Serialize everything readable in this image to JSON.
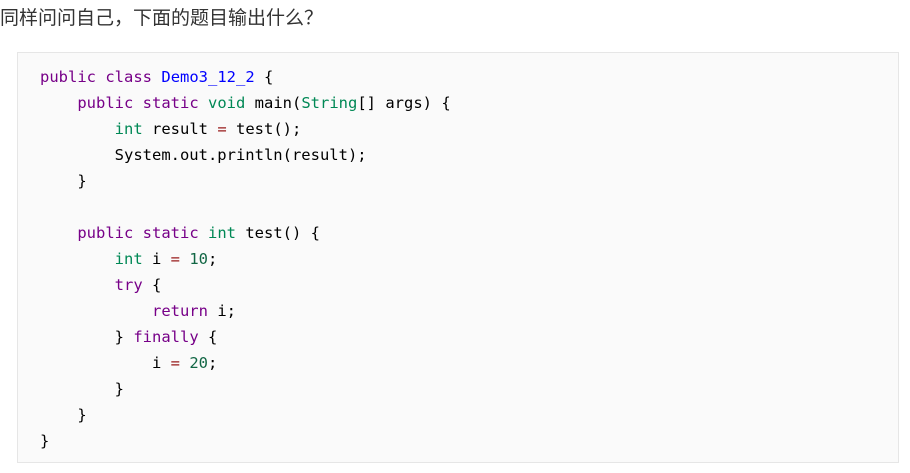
{
  "question": "同样问问自己，下面的题目输出什么？",
  "code": {
    "lines": [
      [
        {
          "t": "kw",
          "v": "public"
        },
        {
          "t": "pl",
          "v": " "
        },
        {
          "t": "kw",
          "v": "class"
        },
        {
          "t": "pl",
          "v": " "
        },
        {
          "t": "def",
          "v": "Demo3_12_2"
        },
        {
          "t": "pl",
          "v": " {"
        }
      ],
      [
        {
          "t": "pl",
          "v": "    "
        },
        {
          "t": "kw",
          "v": "public"
        },
        {
          "t": "pl",
          "v": " "
        },
        {
          "t": "kw",
          "v": "static"
        },
        {
          "t": "pl",
          "v": " "
        },
        {
          "t": "ty",
          "v": "void"
        },
        {
          "t": "pl",
          "v": " main("
        },
        {
          "t": "ty",
          "v": "String"
        },
        {
          "t": "pl",
          "v": "[] args) {"
        }
      ],
      [
        {
          "t": "pl",
          "v": "        "
        },
        {
          "t": "ty",
          "v": "int"
        },
        {
          "t": "pl",
          "v": " result "
        },
        {
          "t": "op",
          "v": "="
        },
        {
          "t": "pl",
          "v": " test();"
        }
      ],
      [
        {
          "t": "pl",
          "v": "        System.out.println(result);"
        }
      ],
      [
        {
          "t": "pl",
          "v": "    }"
        }
      ],
      [
        {
          "t": "pl",
          "v": ""
        }
      ],
      [
        {
          "t": "pl",
          "v": "    "
        },
        {
          "t": "kw",
          "v": "public"
        },
        {
          "t": "pl",
          "v": " "
        },
        {
          "t": "kw",
          "v": "static"
        },
        {
          "t": "pl",
          "v": " "
        },
        {
          "t": "ty",
          "v": "int"
        },
        {
          "t": "pl",
          "v": " test() {"
        }
      ],
      [
        {
          "t": "pl",
          "v": "        "
        },
        {
          "t": "ty",
          "v": "int"
        },
        {
          "t": "pl",
          "v": " i "
        },
        {
          "t": "op",
          "v": "="
        },
        {
          "t": "pl",
          "v": " "
        },
        {
          "t": "num",
          "v": "10"
        },
        {
          "t": "pl",
          "v": ";"
        }
      ],
      [
        {
          "t": "pl",
          "v": "        "
        },
        {
          "t": "kw",
          "v": "try"
        },
        {
          "t": "pl",
          "v": " {"
        }
      ],
      [
        {
          "t": "pl",
          "v": "            "
        },
        {
          "t": "kw",
          "v": "return"
        },
        {
          "t": "pl",
          "v": " i;"
        }
      ],
      [
        {
          "t": "pl",
          "v": "        } "
        },
        {
          "t": "kw",
          "v": "finally"
        },
        {
          "t": "pl",
          "v": " {"
        }
      ],
      [
        {
          "t": "pl",
          "v": "            i "
        },
        {
          "t": "op",
          "v": "="
        },
        {
          "t": "pl",
          "v": " "
        },
        {
          "t": "num",
          "v": "20"
        },
        {
          "t": "pl",
          "v": ";"
        }
      ],
      [
        {
          "t": "pl",
          "v": "        }"
        }
      ],
      [
        {
          "t": "pl",
          "v": "    }"
        }
      ],
      [
        {
          "t": "pl",
          "v": "}"
        }
      ]
    ]
  },
  "colors": {
    "keyword": "#770088",
    "type": "#008855",
    "definition": "#0000ff",
    "number": "#116644",
    "operator": "#981a1a",
    "code_background": "#fafafa",
    "code_border": "#e6e6e6"
  }
}
